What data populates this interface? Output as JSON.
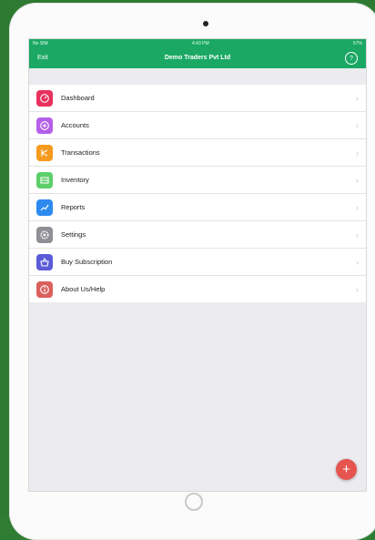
{
  "status_bar": {
    "carrier": "No SIM",
    "time": "4:43 PM",
    "battery": "57%"
  },
  "nav": {
    "exit_label": "Exit",
    "title": "Demo Traders Pvt Ltd",
    "help_symbol": "?"
  },
  "menu": {
    "items": [
      {
        "label": "Dashboard",
        "icon": "dashboard-icon",
        "color": "#e8315d"
      },
      {
        "label": "Accounts",
        "icon": "accounts-icon",
        "color": "#b560e8"
      },
      {
        "label": "Transactions",
        "icon": "transactions-icon",
        "color": "#f59a1d"
      },
      {
        "label": "Inventory",
        "icon": "inventory-icon",
        "color": "#5ccf6a"
      },
      {
        "label": "Reports",
        "icon": "reports-icon",
        "color": "#2d8bf0"
      },
      {
        "label": "Settings",
        "icon": "settings-icon",
        "color": "#8f8f95"
      },
      {
        "label": "Buy Subscription",
        "icon": "subscription-icon",
        "color": "#5b5bd8"
      },
      {
        "label": "About Us/Help",
        "icon": "about-icon",
        "color": "#d9605c"
      }
    ],
    "chevron": "›"
  },
  "fab": {
    "symbol": "+",
    "icon": "add-icon",
    "color": "#e5544f"
  }
}
